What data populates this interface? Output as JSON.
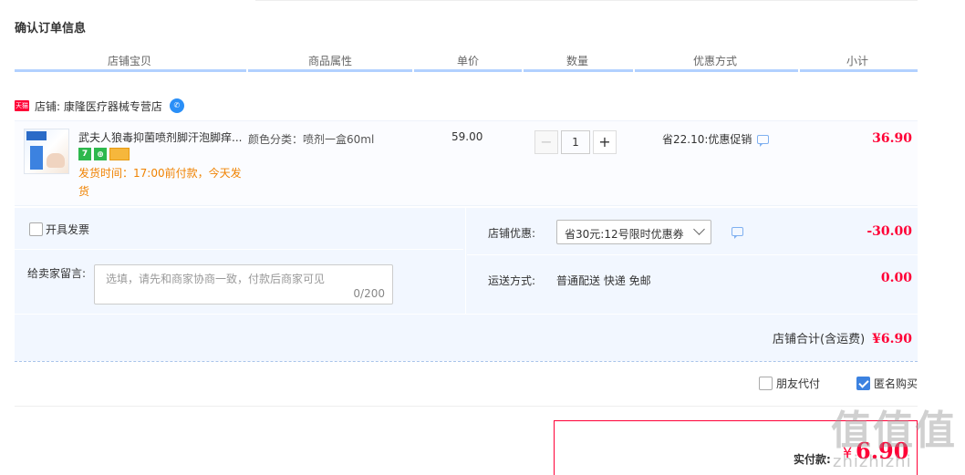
{
  "page": {
    "title": "确认订单信息"
  },
  "columns": [
    "店铺宝贝",
    "商品属性",
    "单价",
    "数量",
    "优惠方式",
    "小计"
  ],
  "shop": {
    "badge": "天猫",
    "label": "店铺: 康隆医疗器械专营店",
    "chat_icon": "wangwang-icon"
  },
  "item": {
    "title": "武夫人狼毒抑菌喷剂脚汗泡脚痒...",
    "attribute": "颜色分类：喷剂一盒60ml",
    "price": "59.00",
    "quantity": "1",
    "service_icons": [
      "seven-day-return-icon",
      "certified-icon",
      "credit-card-icon"
    ],
    "service_7": "7",
    "service_cert": "⊕",
    "ship_note": "发货时间：17:00前付款，今天发货",
    "promo": "省22.10:优惠促销",
    "subtotal": "36.90"
  },
  "invoice": {
    "label": "开具发票",
    "checked": false
  },
  "message": {
    "label": "给卖家留言:",
    "placeholder": "选填，请先和商家协商一致，付款后商家可见",
    "count": "0/200"
  },
  "coupon": {
    "label": "店铺优惠:",
    "selected": "省30元:12号限时优惠券",
    "amount": "-30.00"
  },
  "shipping": {
    "label": "运送方式:",
    "method": "普通配送 快递 免邮",
    "fee": "0.00"
  },
  "shop_total": {
    "label": "店铺合计(含运费)",
    "value": "¥6.90"
  },
  "options": {
    "friend_pay": {
      "label": "朋友代付",
      "checked": false
    },
    "anonymous": {
      "label": "匿名购买",
      "checked": true
    }
  },
  "payment": {
    "label": "实付款:",
    "currency": "¥",
    "amount": "6.90"
  },
  "watermark": {
    "glyphs": "值值值",
    "text": "zhizhizhi"
  },
  "colors": {
    "accent_red": "#ff0036",
    "accent_blue": "#3c82e0",
    "header_underline": "#b2d1ff",
    "panel_bg": "#f2f7ff",
    "ship_note": "#f08200"
  }
}
